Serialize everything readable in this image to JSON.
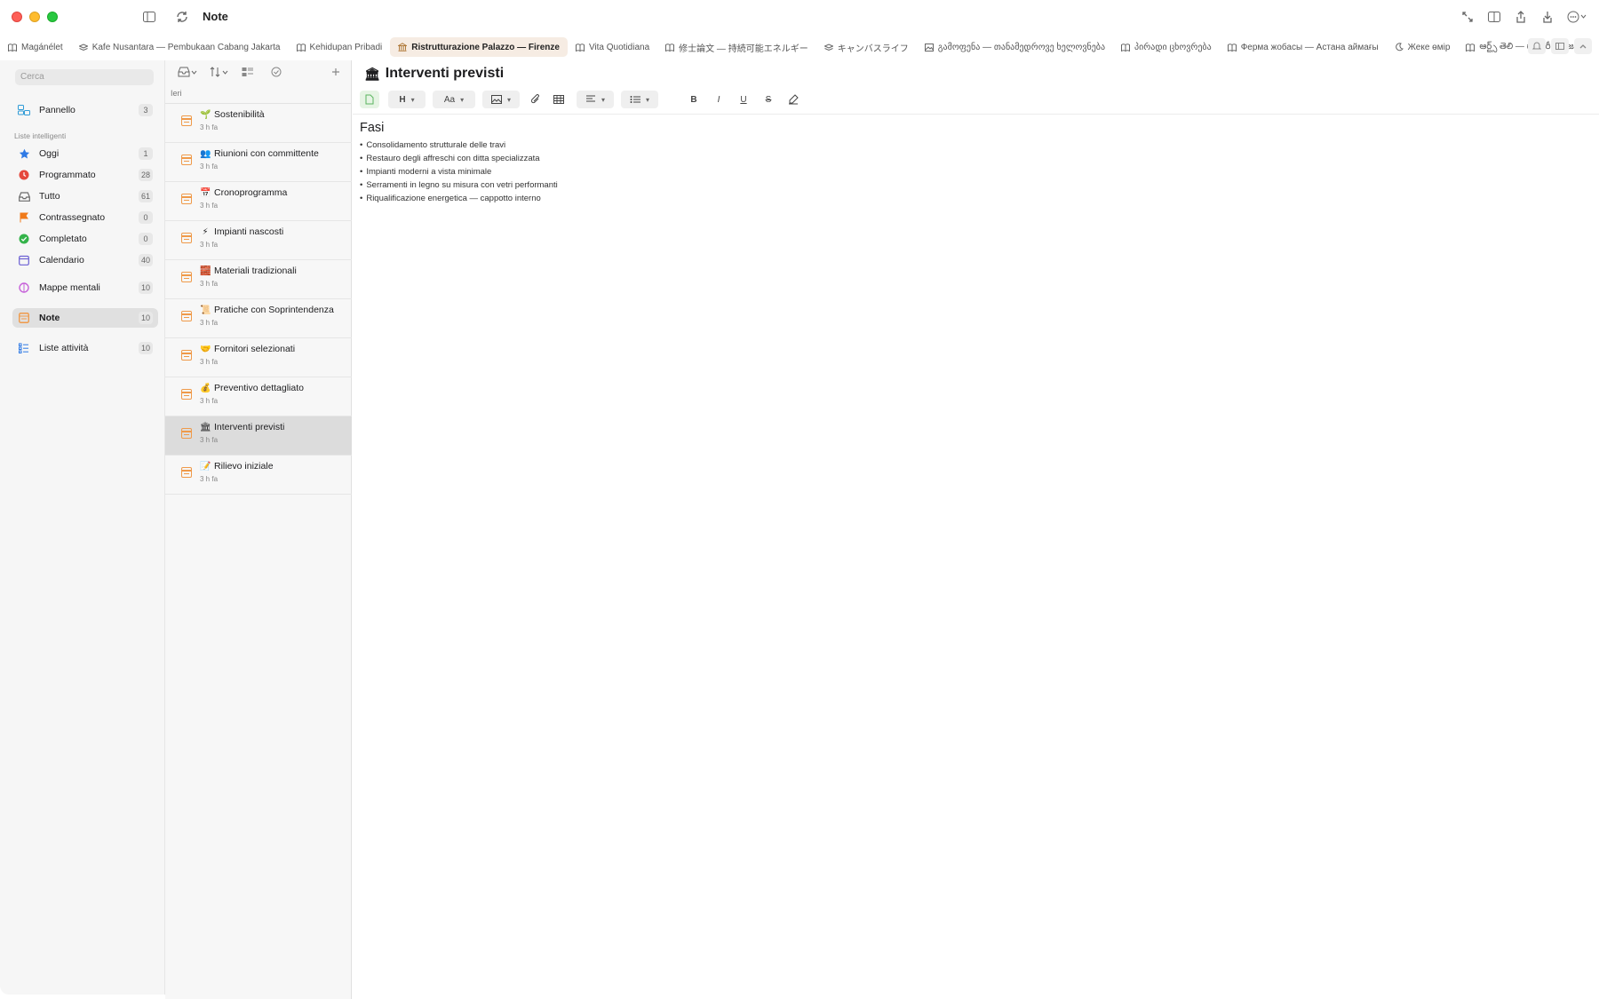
{
  "window": {
    "title": "Note"
  },
  "tabs": [
    {
      "label": "Magánélet",
      "icon": "book-icon"
    },
    {
      "label": "Kafe Nusantara — Pembukaan Cabang Jakarta",
      "icon": "stack-icon"
    },
    {
      "label": "Kehidupan Pribadi",
      "icon": "book-icon"
    },
    {
      "label": "Ristrutturazione Palazzo — Firenze",
      "icon": "building-icon",
      "active": true
    },
    {
      "label": "Vita Quotidiana",
      "icon": "book-icon"
    },
    {
      "label": "修士論文 — 持続可能エネルギー",
      "icon": "book-icon"
    },
    {
      "label": "キャンバスライフ",
      "icon": "stack-icon"
    },
    {
      "label": "გამოფენა — თანამედროვე ხელოვნება",
      "icon": "picture-icon"
    },
    {
      "label": "პირადი ცხოვრება",
      "icon": "book-icon"
    },
    {
      "label": "Ферма жобасы — Астана аймағы",
      "icon": "book-icon"
    },
    {
      "label": "Жеке өмір",
      "icon": "moon-icon"
    },
    {
      "label": "ఆర్ట్స్ తెలి — గ్యాలరీ యోజన",
      "icon": "book-icon"
    }
  ],
  "sidebar": {
    "search_placeholder": "Cerca",
    "dashboard": {
      "label": "Pannello",
      "count": "3"
    },
    "section_label": "Liste intelligenti",
    "smart_lists": [
      {
        "label": "Oggi",
        "count": "1",
        "icon": "star-icon",
        "color": "#2f7ae5"
      },
      {
        "label": "Programmato",
        "count": "28",
        "icon": "clock-icon",
        "color": "#e5483d"
      },
      {
        "label": "Tutto",
        "count": "61",
        "icon": "tray-icon",
        "color": "#6b6b6b"
      },
      {
        "label": "Contrassegnato",
        "count": "0",
        "icon": "flag-icon",
        "color": "#f07a1a"
      },
      {
        "label": "Completato",
        "count": "0",
        "icon": "check-circle-icon",
        "color": "#34b34a"
      },
      {
        "label": "Calendario",
        "count": "40",
        "icon": "calendar-icon",
        "color": "#6b5fd3"
      }
    ],
    "mind_maps": {
      "label": "Mappe mentali",
      "count": "10",
      "icon": "brain-icon",
      "color": "#c763d9"
    },
    "notes": {
      "label": "Note",
      "count": "10",
      "icon": "note-icon",
      "color": "#ef9a4a"
    },
    "task_lists": {
      "label": "Liste attività",
      "count": "10",
      "icon": "checklist-icon",
      "color": "#2f7ae5"
    }
  },
  "note_list": {
    "group_header": "Ieri",
    "items": [
      {
        "title": "Sostenibilità",
        "emoji": "🌱",
        "time": "3 h fa"
      },
      {
        "title": "Riunioni con committente",
        "emoji": "👥",
        "time": "3 h fa"
      },
      {
        "title": "Cronoprogramma",
        "emoji": "📅",
        "time": "3 h fa"
      },
      {
        "title": "Impianti nascosti",
        "emoji": "⚡",
        "time": "3 h fa"
      },
      {
        "title": "Materiali tradizionali",
        "emoji": "🧱",
        "time": "3 h fa"
      },
      {
        "title": "Pratiche con Soprintendenza",
        "emoji": "📜",
        "time": "3 h fa"
      },
      {
        "title": "Fornitori selezionati",
        "emoji": "🤝",
        "time": "3 h fa"
      },
      {
        "title": "Preventivo dettagliato",
        "emoji": "💰",
        "time": "3 h fa"
      },
      {
        "title": "Interventi previsti",
        "emoji": "🏛",
        "time": "3 h fa",
        "active": true
      },
      {
        "title": "Rilievo iniziale",
        "emoji": "📝",
        "time": "3 h fa"
      }
    ]
  },
  "editor": {
    "title": "Interventi previsti",
    "title_emoji": "🏛",
    "toolbar": {
      "heading": "H",
      "font": "Aa",
      "bold": "B",
      "italic": "I",
      "underline": "U",
      "strike": "S"
    },
    "heading": "Fasi",
    "bullets": [
      "Consolidamento strutturale delle travi",
      "Restauro degli affreschi con ditta specializzata",
      "Impianti moderni a vista minimale",
      "Serramenti in legno su misura con vetri performanti",
      "Riqualificazione energetica — cappotto interno"
    ]
  }
}
